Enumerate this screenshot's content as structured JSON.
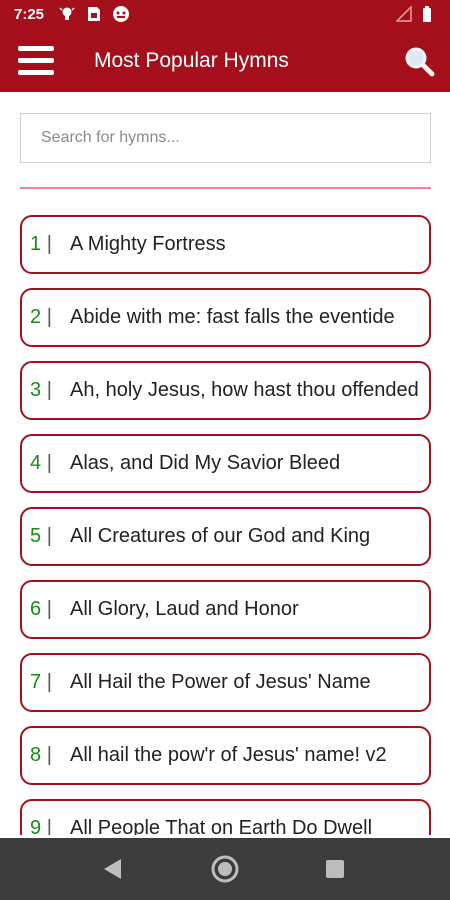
{
  "status_bar": {
    "time": "7:25",
    "icons": [
      "bulb-icon",
      "sim-card-icon",
      "android-icon"
    ],
    "right_icons": [
      "signal-icon",
      "battery-icon"
    ]
  },
  "app_bar": {
    "title": "Most Popular Hymns",
    "menu_icon": "hamburger-menu-icon",
    "search_icon": "search-icon",
    "color": "#a50f1b"
  },
  "search": {
    "placeholder": "Search for hymns...",
    "value": ""
  },
  "hymns": [
    {
      "number": "1",
      "separator": "|",
      "title": "A Mighty Fortress"
    },
    {
      "number": "2",
      "separator": "|",
      "title": "Abide with me: fast falls the eventide"
    },
    {
      "number": "3",
      "separator": "|",
      "title": "Ah, holy Jesus, how hast thou offended"
    },
    {
      "number": "4",
      "separator": "|",
      "title": "Alas, and Did My Savior Bleed"
    },
    {
      "number": "5",
      "separator": "|",
      "title": "All Creatures of our God and King"
    },
    {
      "number": "6",
      "separator": "|",
      "title": "All Glory, Laud and Honor"
    },
    {
      "number": "7",
      "separator": "|",
      "title": "All Hail the Power of Jesus' Name"
    },
    {
      "number": "8",
      "separator": "|",
      "title": "All hail the pow'r of Jesus' name! v2"
    },
    {
      "number": "9",
      "separator": "|",
      "title": "All People That on Earth Do Dwell"
    }
  ],
  "nav_bar": {
    "icons": [
      "back-icon",
      "home-icon",
      "recents-icon"
    ]
  }
}
